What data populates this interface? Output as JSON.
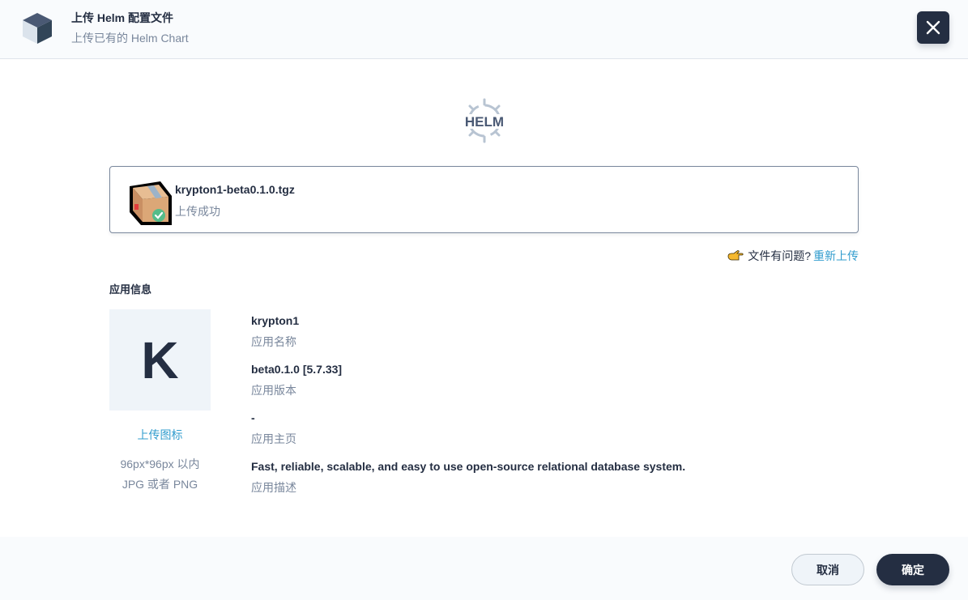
{
  "header": {
    "title": "上传 Helm 配置文件",
    "subtitle": "上传已有的 Helm Chart"
  },
  "helm_logo_text": "HELM",
  "file": {
    "name": "krypton1-beta0.1.0.tgz",
    "status": "上传成功"
  },
  "reupload": {
    "question": "文件有问题?",
    "link": "重新上传"
  },
  "app_info": {
    "section_title": "应用信息",
    "icon_letter": "K",
    "upload_icon_link": "上传图标",
    "icon_hint_line1": "96px*96px 以内",
    "icon_hint_line2": "JPG 或者 PNG",
    "fields": [
      {
        "value": "krypton1",
        "label": "应用名称"
      },
      {
        "value": "beta0.1.0 [5.7.33]",
        "label": "应用版本"
      },
      {
        "value": "-",
        "label": "应用主页"
      },
      {
        "value": "Fast, reliable, scalable, and easy to use open-source relational database system.",
        "label": "应用描述"
      }
    ]
  },
  "footer": {
    "cancel_label": "取消",
    "confirm_label": "确定"
  },
  "colors": {
    "primary_dark": "#242e42",
    "link": "#329dce",
    "muted": "#79879c",
    "success": "#55bc8a"
  }
}
